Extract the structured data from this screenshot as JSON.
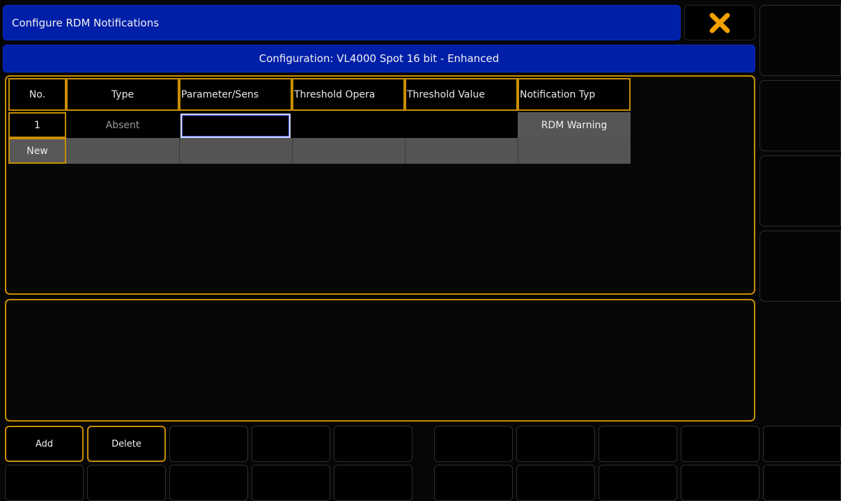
{
  "window": {
    "title": "Configure RDM Notifications",
    "configuration": "Configuration: VL4000 Spot 16 bit - Enhanced",
    "close_icon": "close-icon",
    "close_color": "#f2a000"
  },
  "table": {
    "headers": [
      "No.",
      "Type",
      "Parameter/Sens",
      "Threshold Opera",
      "Threshold Value",
      "Notification Typ"
    ],
    "rows": [
      {
        "no": "1",
        "type": "Absent",
        "parameter": "",
        "operator": "",
        "value": "",
        "notification": "RDM Warning"
      }
    ],
    "new_label": "New"
  },
  "bottom_bar": {
    "add_label": "Add",
    "delete_label": "Delete"
  },
  "colors": {
    "title_blue": "#001fa8",
    "accent_gold": "#c98f00",
    "cell_grey": "#565656"
  }
}
